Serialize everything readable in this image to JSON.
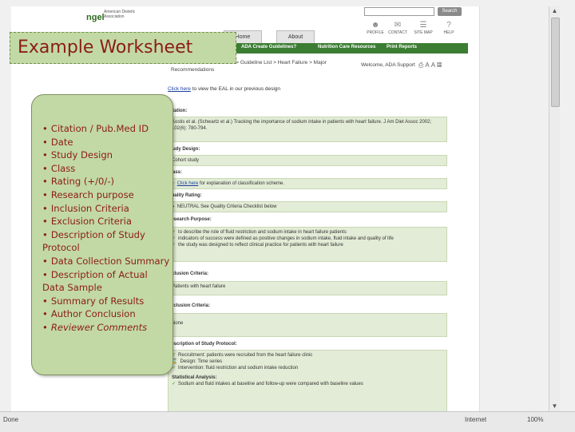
{
  "slide": {
    "title": "Example Worksheet",
    "items": [
      "Citation / Pub.Med ID",
      "Date",
      "Study Design",
      "Class",
      "Rating (+/0/-)",
      "Research purpose",
      "Inclusion Criteria",
      "Exclusion Criteria",
      "Description of Study Protocol",
      "Data Collection Summary",
      "Description of Actual Data Sample",
      "Summary of Results",
      "Author Conclusion",
      "Reviewer Comments"
    ],
    "bullet": "•"
  },
  "site": {
    "logo_mark": "ngel",
    "logo_text": "American Dietetic Association",
    "search_label": "Search",
    "top_icons": [
      "PROFILE",
      "CONTACT",
      "SITE MAP",
      "HELP"
    ],
    "tabs": [
      "Home",
      "About"
    ],
    "nav": [
      "ADA Create Guidelines?",
      "Nutrition Care Resources",
      "Print Reports"
    ],
    "breadcrumb": "Evidence Based Guidelines > Guideline List > Heart Failure > Major Recommendations",
    "welcome": "Welcome, ADA Support",
    "prev_link": "Click here",
    "prev_text": "to view the EAL in our previous design",
    "sections": {
      "citation": "Citation:",
      "citation_text": "Kostis et al. (Schwartz et al.) Tracking the importance of sodium intake in patients with heart failure. J Am Diet Assoc 2002; 102(6): 780-794.",
      "study_design": "Study Design:",
      "study_design_value": "Cohort study",
      "class": "Class:",
      "class_link": "Click here",
      "class_text": "for explanation of classification scheme.",
      "quality": "Quality Rating:",
      "quality_text": "NEUTRAL  See Quality Criteria Checklist below",
      "research_purpose": "Research Purpose:",
      "purpose_items": [
        "to describe the role of fluid restriction and sodium intake in heart failure patients",
        "indicators of success were defined as positive changes in sodium intake, fluid intake and quality of life",
        "the study was designed to reflect clinical practice for patients with heart failure"
      ],
      "inclusion": "Inclusion Criteria:",
      "inclusion_value": "Patients with heart failure",
      "exclusion": "Exclusion Criteria:",
      "exclusion_value": "None",
      "protocol": "Description of Study Protocol:",
      "protocol_items": [
        "Recruitment: patients were recruited from the heart failure clinic",
        "Design: Time series",
        "Intervention: fluid restriction and sodium intake reduction"
      ],
      "stats": "Statistical Analysis:",
      "stats_items": [
        "Sodium and fluid intakes at baseline and follow-up were compared with baseline values"
      ]
    }
  },
  "browser": {
    "status_left": "Done",
    "status_zone": "Internet",
    "status_zoom": "100%"
  }
}
